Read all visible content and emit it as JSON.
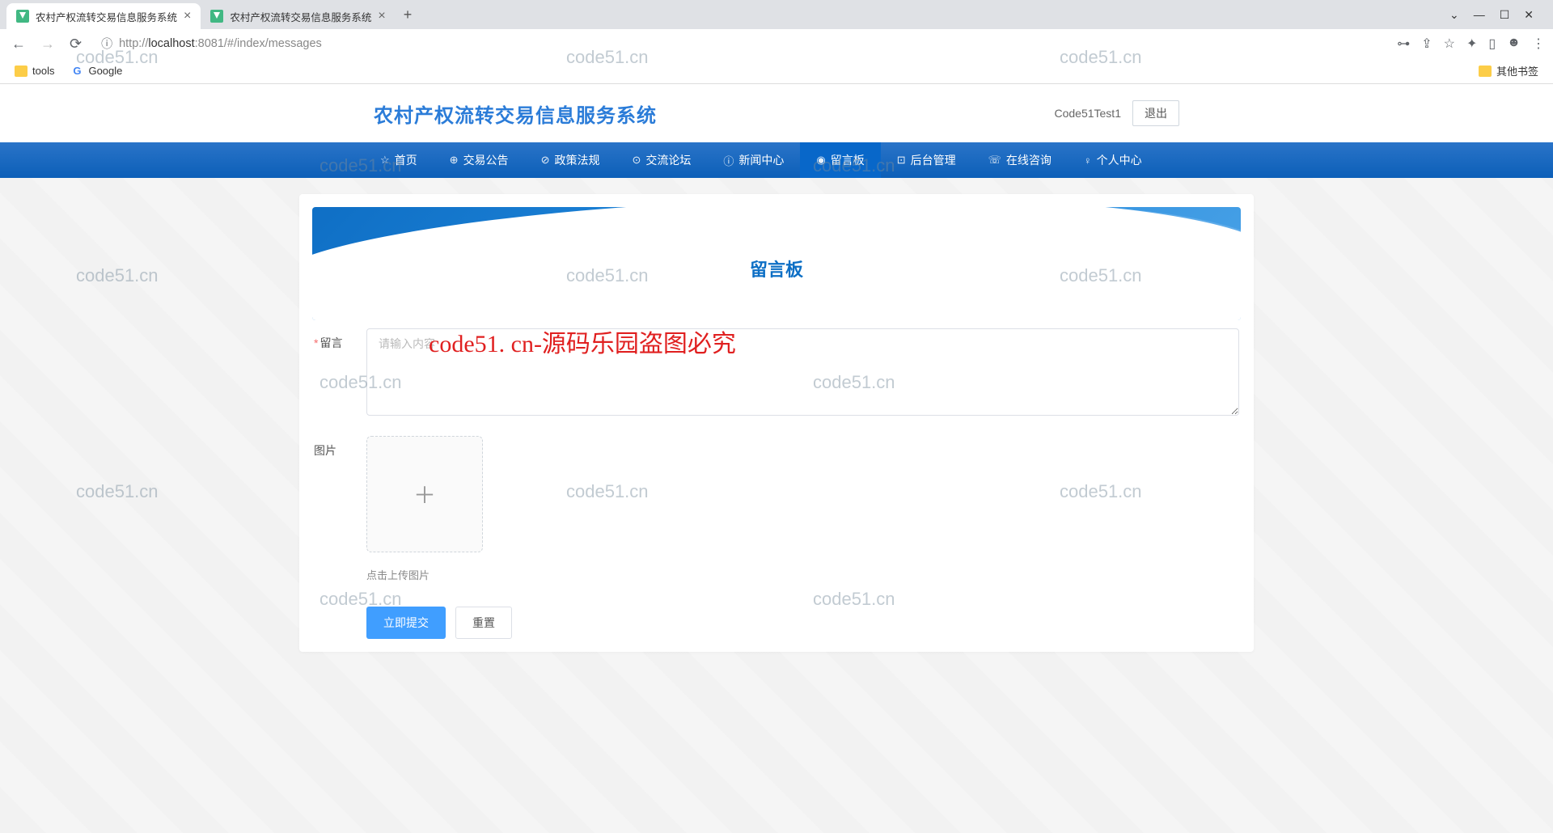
{
  "browser": {
    "tabs": [
      {
        "title": "农村产权流转交易信息服务系统"
      },
      {
        "title": "农村产权流转交易信息服务系统"
      }
    ],
    "url_host": "localhost",
    "url_port": ":8081",
    "url_path": "/#/index/messages",
    "url_prefix": "http://",
    "bookmarks": {
      "tools": "tools",
      "google": "Google",
      "other": "其他书签"
    }
  },
  "header": {
    "logo": "农村产权流转交易信息服务系统",
    "username": "Code51Test1",
    "logout": "退出"
  },
  "nav": {
    "items": [
      {
        "icon": "☆",
        "label": "首页"
      },
      {
        "icon": "⊕",
        "label": "交易公告"
      },
      {
        "icon": "⊘",
        "label": "政策法规"
      },
      {
        "icon": "⊙",
        "label": "交流论坛"
      },
      {
        "icon": "ⓘ",
        "label": "新闻中心"
      },
      {
        "icon": "◉",
        "label": "留言板",
        "active": true
      },
      {
        "icon": "⊡",
        "label": "后台管理"
      },
      {
        "icon": "☏",
        "label": "在线咨询"
      },
      {
        "icon": "♀",
        "label": "个人中心"
      }
    ]
  },
  "banner": {
    "title": "留言板"
  },
  "form": {
    "message_label": "留言",
    "message_placeholder": "请输入内容",
    "image_label": "图片",
    "upload_hint": "点击上传图片",
    "submit": "立即提交",
    "reset": "重置"
  },
  "watermarks": {
    "grey": "code51.cn",
    "red": "code51. cn-源码乐园盗图必究"
  }
}
